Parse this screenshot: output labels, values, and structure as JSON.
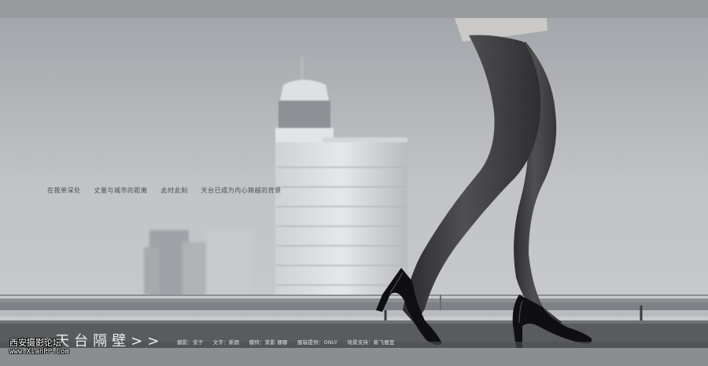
{
  "tagline": {
    "part1": "在我单深处",
    "part2": "丈量与城市的距离",
    "part3": "此时此刻",
    "part4": "天台已成为内心跨越的背景"
  },
  "title": "<<天台隔壁>>",
  "credits": {
    "photo": "摄影：安子",
    "text": "文字：新颜",
    "model": "模特：菜影  娜娜",
    "costume": "服装提供：ONLY",
    "venue": "场景支持：新飞丽室"
  },
  "watermark": {
    "line1": "西安摄影论坛",
    "line2": "www.XianPP.Com"
  },
  "colors": {
    "sky": "#b7b9bc",
    "frame": "#8f9094",
    "stockings": "#2a2a2c",
    "shoes": "#101012"
  }
}
